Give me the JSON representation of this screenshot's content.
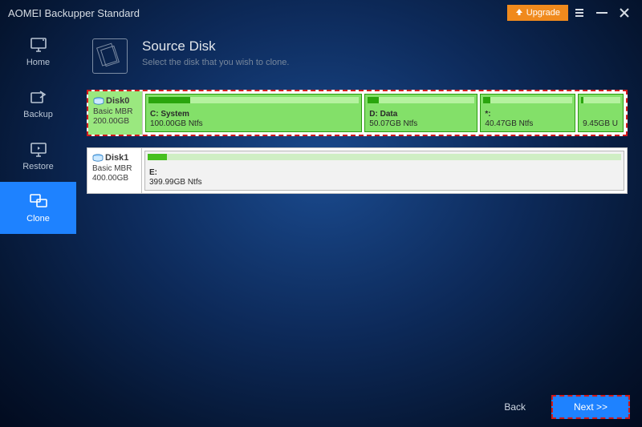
{
  "titlebar": {
    "app_name": "AOMEI Backupper Standard",
    "upgrade_label": "Upgrade"
  },
  "sidebar": {
    "items": [
      {
        "key": "home",
        "label": "Home"
      },
      {
        "key": "backup",
        "label": "Backup"
      },
      {
        "key": "restore",
        "label": "Restore"
      },
      {
        "key": "clone",
        "label": "Clone"
      }
    ],
    "active": "clone"
  },
  "page": {
    "title": "Source Disk",
    "subtitle": "Select the disk that you wish to clone."
  },
  "disks": [
    {
      "name": "Disk0",
      "type": "Basic MBR",
      "size": "200.00GB",
      "selected": true,
      "partitions": [
        {
          "label": "C: System",
          "size": "100.00GB Ntfs",
          "flex": 46,
          "used": 20
        },
        {
          "label": "D: Data",
          "size": "50.07GB Ntfs",
          "flex": 23,
          "used": 10
        },
        {
          "label": "*:",
          "size": "40.47GB Ntfs",
          "flex": 19,
          "used": 8
        },
        {
          "label": "",
          "size": "9.45GB U",
          "flex": 8,
          "used": 6
        }
      ]
    },
    {
      "name": "Disk1",
      "type": "Basic MBR",
      "size": "400.00GB",
      "selected": false,
      "partitions": [
        {
          "label": "E:",
          "size": "399.99GB Ntfs",
          "flex": 100,
          "used": 4
        }
      ]
    }
  ],
  "footer": {
    "back_label": "Back",
    "next_label": "Next >>"
  }
}
